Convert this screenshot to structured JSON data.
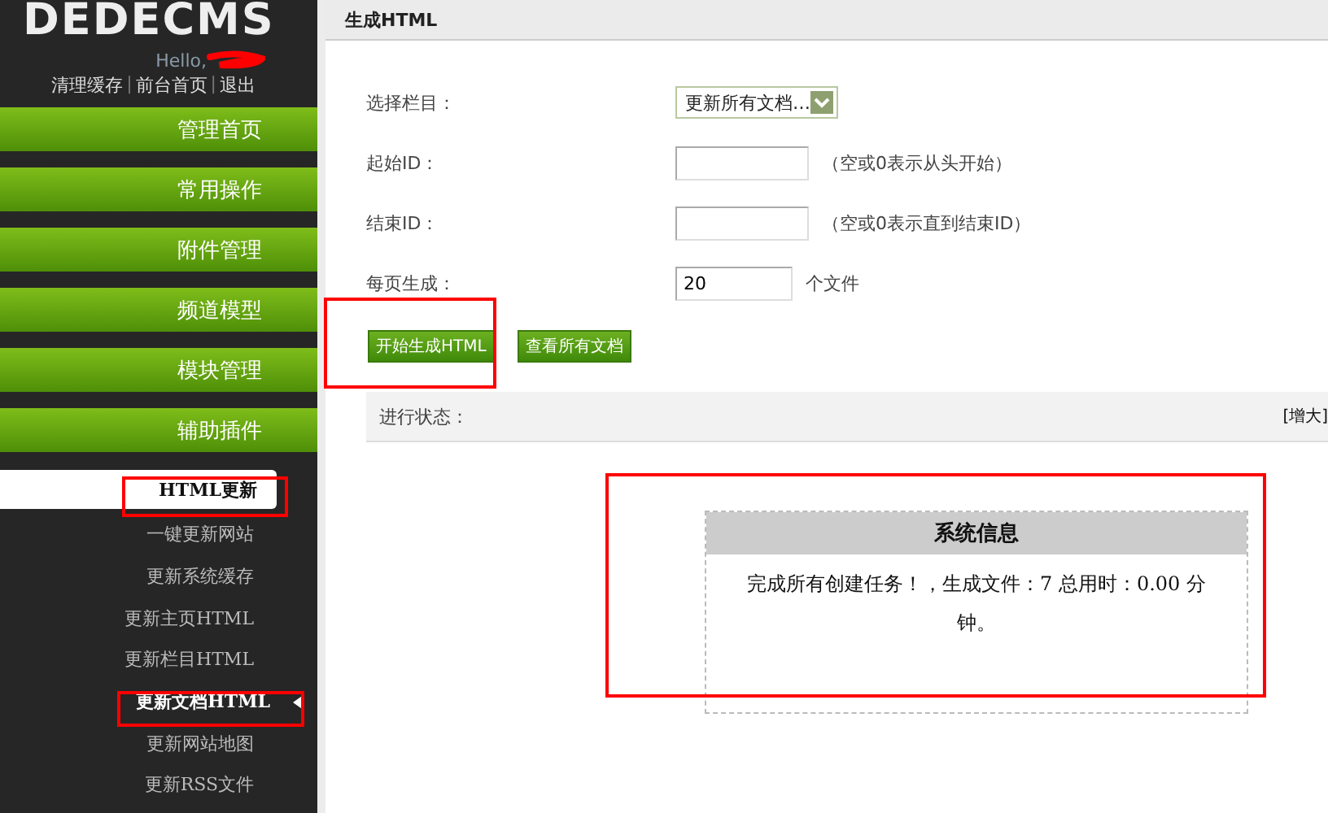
{
  "sidebar": {
    "logo": "DEDECMS",
    "greeting": "Hello,",
    "links": [
      "清理缓存",
      "前台首页",
      "退出"
    ],
    "link_separator": "|",
    "menu": [
      "管理首页",
      "常用操作",
      "附件管理",
      "频道模型",
      "模块管理",
      "辅助插件"
    ],
    "submenu": {
      "title": "HTML更新",
      "items": [
        {
          "label": "一键更新网站",
          "selected": false
        },
        {
          "label": "更新系统缓存",
          "selected": false
        },
        {
          "label": "更新主页HTML",
          "selected": false
        },
        {
          "label": "更新栏目HTML",
          "selected": false
        },
        {
          "label": "更新文档HTML",
          "selected": true
        },
        {
          "label": "更新网站地图",
          "selected": false
        },
        {
          "label": "更新RSS文件",
          "selected": false
        }
      ]
    }
  },
  "main": {
    "title": "生成HTML",
    "fields": [
      {
        "kind": "select",
        "label": "选择栏目：",
        "value": "更新所有文档…"
      },
      {
        "kind": "input",
        "label": "起始ID：",
        "hint": "（空或0表示从头开始）"
      },
      {
        "kind": "input",
        "label": "结束ID：",
        "hint": "（空或0表示直到结束ID）"
      },
      {
        "kind": "short-input",
        "label": "每页生成：",
        "value": "20",
        "hint": "个文件"
      }
    ],
    "buttons": [
      "开始生成HTML",
      "查看所有文档"
    ],
    "status": {
      "label": "进行状态：",
      "toggle": "[增大]"
    },
    "message": {
      "title": "系统信息",
      "text": "完成所有创建任务！，生成文件：7 总用时：0.00 分钟。"
    }
  }
}
